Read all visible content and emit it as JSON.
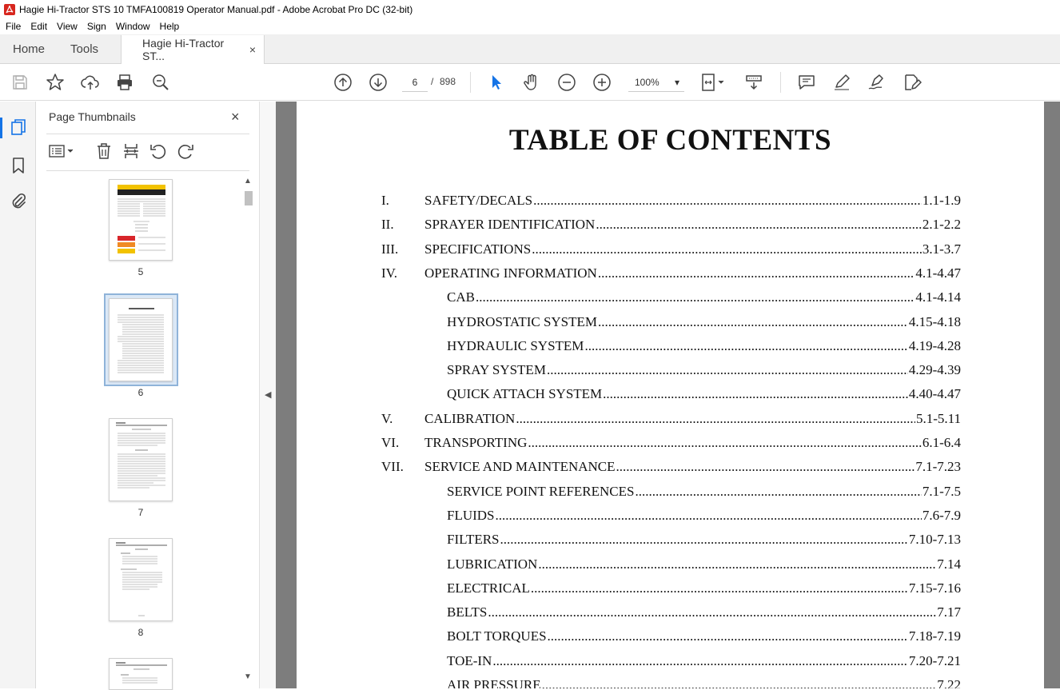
{
  "window": {
    "title": "Hagie Hi-Tractor STS 10 TMFA100819 Operator Manual.pdf - Adobe Acrobat Pro DC (32-bit)",
    "app_icon": "acrobat-icon"
  },
  "menu": [
    "File",
    "Edit",
    "View",
    "Sign",
    "Window",
    "Help"
  ],
  "tabs": {
    "home": "Home",
    "tools": "Tools",
    "document": "Hagie Hi-Tractor ST...",
    "close": "×"
  },
  "toolbar": {
    "page_current": "6",
    "page_separator": "/",
    "page_total": "898",
    "zoom": "100%",
    "zoom_caret": "▾"
  },
  "sidebar": {
    "title": "Page Thumbnails",
    "close": "×",
    "thumbnails": [
      {
        "label": "5"
      },
      {
        "label": "6",
        "selected": true
      },
      {
        "label": "7"
      },
      {
        "label": "8"
      }
    ]
  },
  "document": {
    "title": "TABLE OF CONTENTS",
    "toc": [
      {
        "num": "I.",
        "label": "SAFETY/DECALS",
        "pages": "1.1-1.9",
        "indent": false
      },
      {
        "num": "II.",
        "label": "SPRAYER IDENTIFICATION",
        "pages": "2.1-2.2",
        "indent": false
      },
      {
        "num": "III.",
        "label": "SPECIFICATIONS",
        "pages": "3.1-3.7",
        "indent": false
      },
      {
        "num": "IV.",
        "label": "OPERATING INFORMATION",
        "pages": "4.1-4.47",
        "indent": false
      },
      {
        "num": "",
        "label": "CAB",
        "pages": "4.1-4.14",
        "indent": true
      },
      {
        "num": "",
        "label": "HYDROSTATIC SYSTEM",
        "pages": "4.15-4.18",
        "indent": true
      },
      {
        "num": "",
        "label": "HYDRAULIC SYSTEM",
        "pages": "4.19-4.28",
        "indent": true
      },
      {
        "num": "",
        "label": "SPRAY SYSTEM",
        "pages": "4.29-4.39",
        "indent": true
      },
      {
        "num": "",
        "label": "QUICK ATTACH SYSTEM",
        "pages": "4.40-4.47",
        "indent": true
      },
      {
        "num": "V.",
        "label": "CALIBRATION",
        "pages": "5.1-5.11",
        "indent": false
      },
      {
        "num": "VI.",
        "label": "TRANSPORTING",
        "pages": "6.1-6.4",
        "indent": false
      },
      {
        "num": "VII.",
        "label": "SERVICE AND MAINTENANCE",
        "pages": "7.1-7.23",
        "indent": false
      },
      {
        "num": "",
        "label": "SERVICE POINT REFERENCES",
        "pages": "7.1-7.5",
        "indent": true
      },
      {
        "num": "",
        "label": "FLUIDS",
        "pages": "7.6-7.9",
        "indent": true
      },
      {
        "num": "",
        "label": "FILTERS",
        "pages": "7.10-7.13",
        "indent": true
      },
      {
        "num": "",
        "label": "LUBRICATION",
        "pages": "7.14",
        "indent": true
      },
      {
        "num": "",
        "label": "ELECTRICAL",
        "pages": "7.15-7.16",
        "indent": true
      },
      {
        "num": "",
        "label": "BELTS",
        "pages": "7.17",
        "indent": true
      },
      {
        "num": "",
        "label": "BOLT TORQUES",
        "pages": "7.18-7.19",
        "indent": true
      },
      {
        "num": "",
        "label": "TOE-IN",
        "pages": "7.20-7.21",
        "indent": true
      },
      {
        "num": "",
        "label": "AIR PRESSURE",
        "pages": "7.22",
        "indent": true
      }
    ]
  },
  "colors": {
    "accent": "#1473e6",
    "acrobat_red": "#d7261e",
    "doc_background": "#7d7d7d"
  }
}
